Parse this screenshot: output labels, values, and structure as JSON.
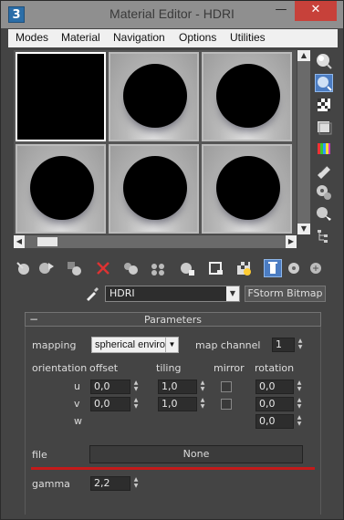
{
  "window": {
    "title": "Material Editor - HDRI",
    "minimize_glyph": "—",
    "close_glyph": "✕",
    "logo_glyph": "3"
  },
  "menu": [
    "Modes",
    "Material",
    "Navigation",
    "Options",
    "Utilities"
  ],
  "material": {
    "name": "HDRI",
    "type_button": "FStorm Bitmap"
  },
  "parameters": {
    "title": "Parameters",
    "collapse_glyph": "−",
    "mapping_label": "mapping",
    "mapping_value": "spherical enviro",
    "map_channel_label": "map channel",
    "map_channel_value": "1",
    "orientation_label": "orientation",
    "offset_label": "offset",
    "tiling_label": "tiling",
    "mirror_label": "mirror",
    "rotation_label": "rotation",
    "u_label": "u",
    "v_label": "v",
    "w_label": "w",
    "offset_u": "0,0",
    "offset_v": "0,0",
    "tiling_u": "1,0",
    "tiling_v": "1,0",
    "rotation_u": "0,0",
    "rotation_v": "0,0",
    "rotation_w": "0,0",
    "file_label": "file",
    "file_button": "None",
    "gamma_label": "gamma",
    "gamma_value": "2,2"
  },
  "colors": {
    "accent_selected": "#4b7cc2",
    "file_underline": "#c41a1a",
    "close_button": "#c7413a"
  }
}
